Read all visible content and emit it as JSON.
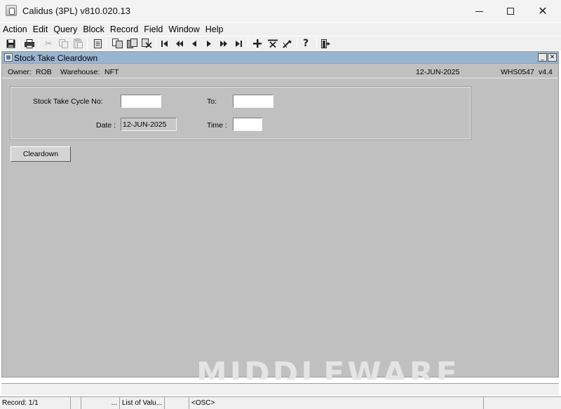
{
  "window": {
    "title": "Calidus (3PL) v810.020.13"
  },
  "menu": [
    "Action",
    "Edit",
    "Query",
    "Block",
    "Record",
    "Field",
    "Window",
    "Help"
  ],
  "toolbar": {
    "icons": [
      "save-icon",
      "print-icon",
      "cut-icon",
      "copy-icon",
      "paste-icon",
      "clear-icon",
      "insert-icon",
      "duplicate-icon",
      "delete-icon",
      "first-record-icon",
      "previous-set-icon",
      "previous-record-icon",
      "next-record-icon",
      "next-set-icon",
      "last-record-icon",
      "insert-record-icon",
      "delete-record-icon",
      "edit-field-icon",
      "help-icon",
      "exit-icon"
    ],
    "help_glyph": "?"
  },
  "form_window": {
    "title": "Stock Take Cleardown",
    "owner_label": "Owner:",
    "owner_value": "ROB",
    "warehouse_label": "Warehouse:",
    "warehouse_value": "NFT",
    "date": "12-JUN-2025",
    "form_code": "WHS0547",
    "version": "v4.4"
  },
  "form": {
    "cycle_label": "Stock Take Cycle No:",
    "cycle_from_value": "",
    "to_label": "To:",
    "cycle_to_value": "",
    "date_label": "Date :",
    "date_value": "12-JUN-2025",
    "time_label": "Time :",
    "time_value": ""
  },
  "buttons": {
    "cleardown": "Cleardown"
  },
  "watermark": "MIDDLEWARE",
  "status": {
    "record": "Record: 1/1",
    "dots": "...",
    "list_of_values": "List of Valu...",
    "mode": "<OSC>"
  }
}
